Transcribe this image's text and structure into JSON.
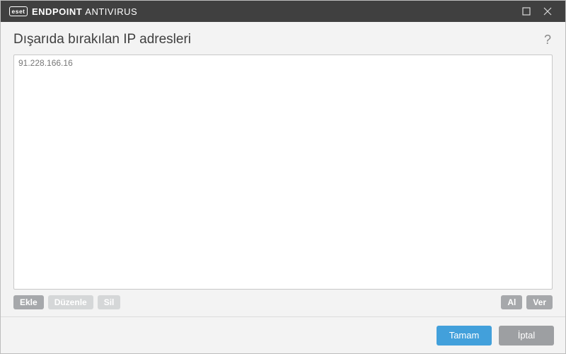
{
  "titlebar": {
    "logo_text": "eset",
    "brand_strong": "ENDPOINT",
    "brand_light": "ANTIVIRUS"
  },
  "header": {
    "title": "Dışarıda bırakılan IP adresleri",
    "help": "?"
  },
  "list": {
    "items": [
      "91.228.166.16"
    ]
  },
  "toolbar": {
    "add": "Ekle",
    "edit": "Düzenle",
    "delete": "Sil",
    "import": "Al",
    "export": "Ver"
  },
  "footer": {
    "ok": "Tamam",
    "cancel": "İptal"
  }
}
